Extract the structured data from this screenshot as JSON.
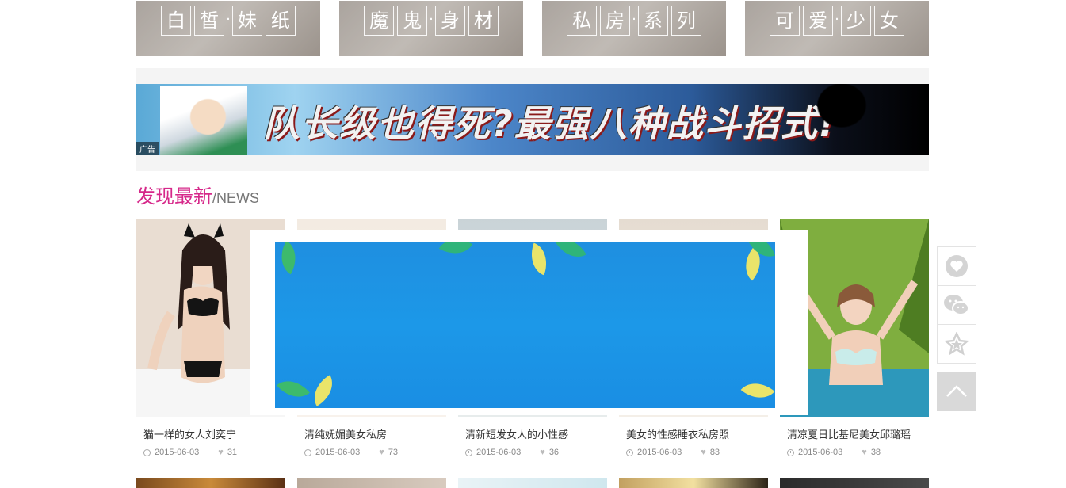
{
  "categories": [
    {
      "chars": [
        "白",
        "皙",
        "妹",
        "纸"
      ]
    },
    {
      "chars": [
        "魔",
        "鬼",
        "身",
        "材"
      ]
    },
    {
      "chars": [
        "私",
        "房",
        "系",
        "列"
      ]
    },
    {
      "chars": [
        "可",
        "爱",
        "少",
        "女"
      ]
    }
  ],
  "banner": {
    "headline": "队长级也得死?最强八种战斗招式!",
    "ad_tag": "广告"
  },
  "section": {
    "title_cn": "发现最新",
    "title_en": "/NEWS"
  },
  "cards": [
    {
      "title": "猫一样的女人刘奕宁",
      "date": "2015-06-03",
      "likes": "31"
    },
    {
      "title": "清纯妩媚美女私房",
      "date": "2015-06-03",
      "likes": "73"
    },
    {
      "title": "清新短发女人的小性感",
      "date": "2015-06-03",
      "likes": "36"
    },
    {
      "title": "美女的性感睡衣私房照",
      "date": "2015-06-03",
      "likes": "83"
    },
    {
      "title": "清凉夏日比基尼美女邱璐瑶",
      "date": "2015-06-03",
      "likes": "38"
    }
  ],
  "side_tools": [
    {
      "icon": "heart-icon"
    },
    {
      "icon": "wechat-icon"
    },
    {
      "icon": "star-icon"
    },
    {
      "icon": "back-to-top-icon"
    }
  ],
  "colors": {
    "accent": "#d6288a",
    "popup_bg": "#1c98e8"
  }
}
